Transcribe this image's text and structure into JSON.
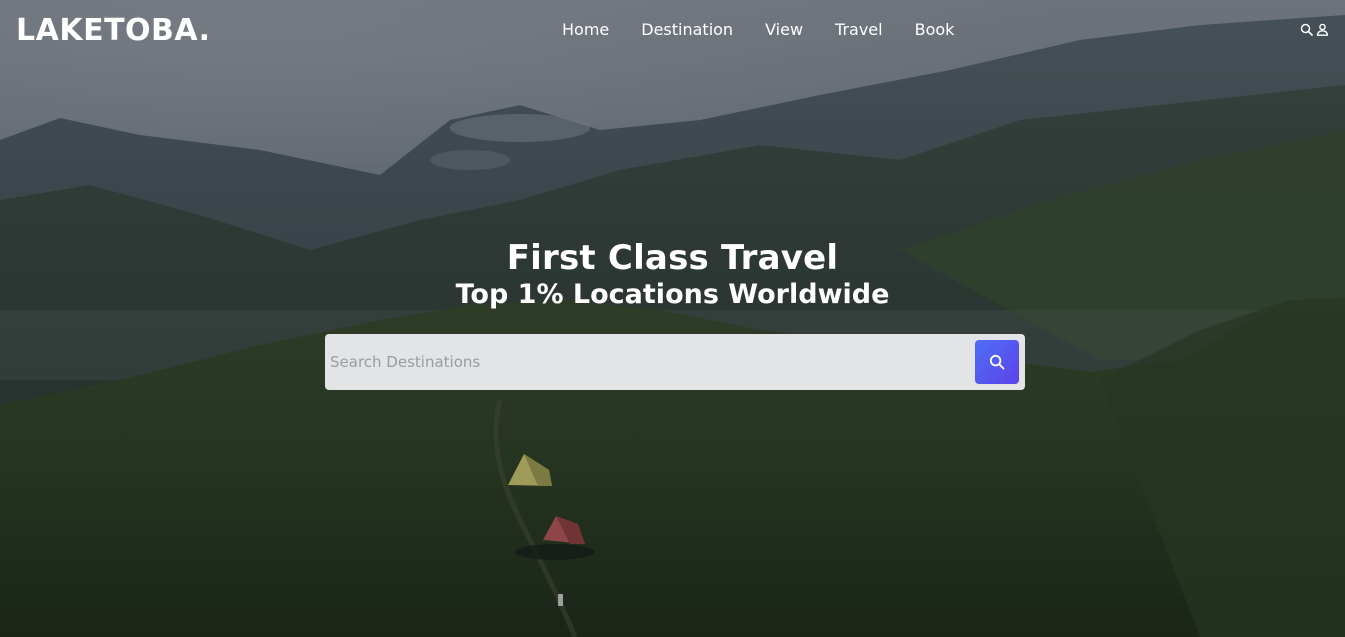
{
  "brand": {
    "logo_text": "LAKETOBA."
  },
  "nav": {
    "items": [
      {
        "label": "Home"
      },
      {
        "label": "Destination"
      },
      {
        "label": "View"
      },
      {
        "label": "Travel"
      },
      {
        "label": "Book"
      }
    ],
    "icons": [
      "search-icon",
      "user-icon"
    ]
  },
  "hero": {
    "title": "First Class Travel",
    "subtitle": "Top 1% Locations Worldwide"
  },
  "search": {
    "placeholder": "Search Destinations",
    "value": "",
    "button_icon": "search-icon"
  },
  "colors": {
    "text": "#ffffff",
    "search_bg": "#ecedf0",
    "button_gradient_start": "#4f6ef7",
    "button_gradient_end": "#5b43e8"
  }
}
